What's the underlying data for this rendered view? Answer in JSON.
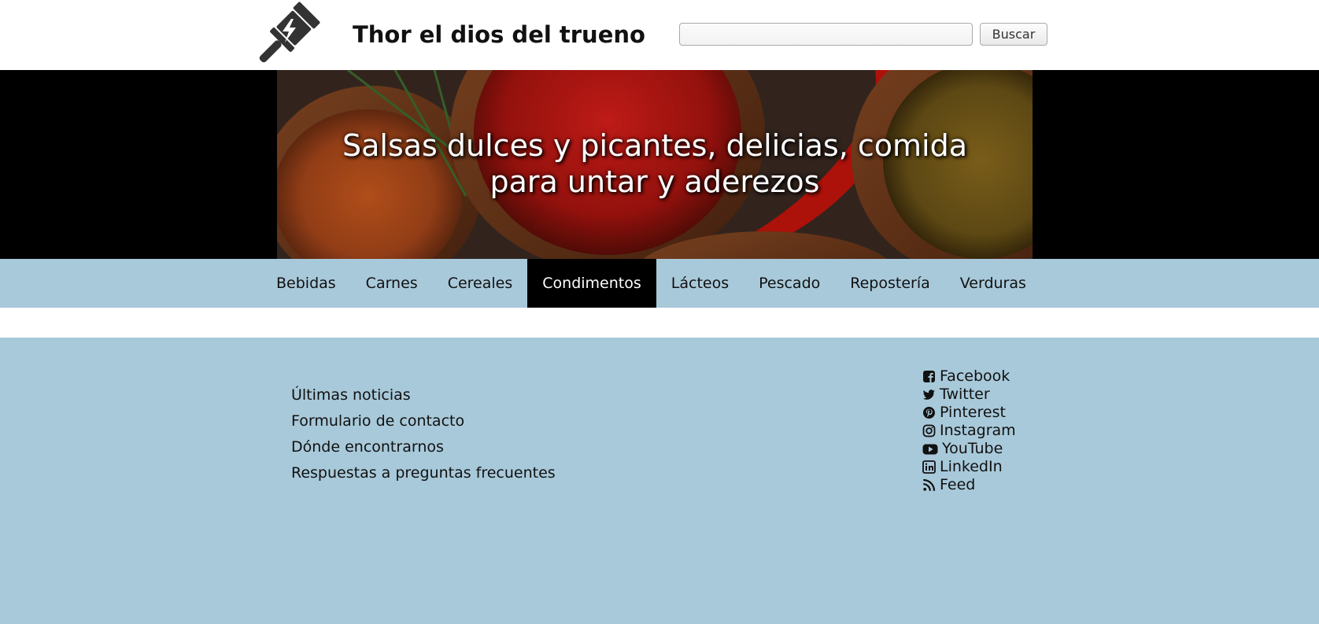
{
  "header": {
    "logo_icon": "gavel-lightning-icon",
    "site_title": "Thor el dios del trueno",
    "search": {
      "placeholder": "",
      "value": ""
    },
    "search_button_label": "Buscar"
  },
  "banner": {
    "headline_line1": "Salsas dulces y picantes, delicias, comida",
    "headline_line2": "para untar y aderezos"
  },
  "nav": {
    "items": [
      {
        "label": "Bebidas"
      },
      {
        "label": "Carnes"
      },
      {
        "label": "Cereales"
      },
      {
        "label": "Condimentos",
        "active": true
      },
      {
        "label": "Lácteos"
      },
      {
        "label": "Pescado"
      },
      {
        "label": "Repostería"
      },
      {
        "label": "Verduras"
      }
    ]
  },
  "footer": {
    "links": [
      {
        "label": "Últimas noticias"
      },
      {
        "label": "Formulario de contacto"
      },
      {
        "label": "Dónde encontrarnos"
      },
      {
        "label": "Respuestas a preguntas frecuentes"
      }
    ],
    "social": [
      {
        "label": "Facebook",
        "icon": "facebook-square-icon"
      },
      {
        "label": "Twitter",
        "icon": "twitter-icon"
      },
      {
        "label": "Pinterest",
        "icon": "pinterest-icon"
      },
      {
        "label": "Instagram",
        "icon": "instagram-icon"
      },
      {
        "label": "YouTube",
        "icon": "youtube-icon"
      },
      {
        "label": "LinkedIn",
        "icon": "linkedin-icon"
      },
      {
        "label": "Feed",
        "icon": "rss-icon"
      }
    ]
  },
  "colors": {
    "nav_background": "#a8c9da",
    "footer_background": "#a8c9da",
    "active_nav_background": "#000000",
    "banner_background": "#000000"
  }
}
